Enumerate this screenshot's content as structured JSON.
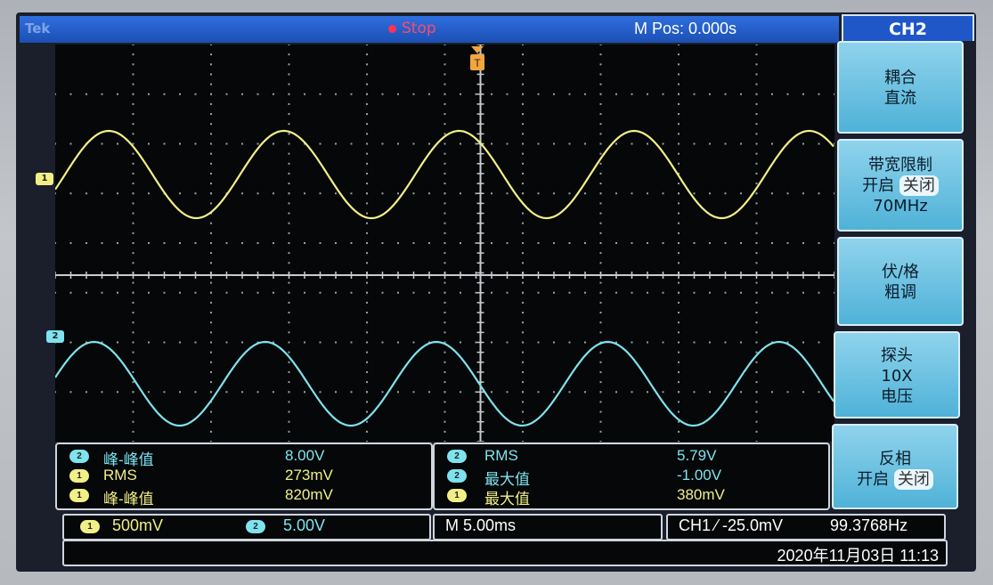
{
  "topbar": {
    "brand": "Tek",
    "status": "Stop",
    "mpos": "M Pos: 0.000s"
  },
  "trigger_marker": "T",
  "channels": {
    "ch1": {
      "label": "1",
      "color": "#f2ef86"
    },
    "ch2": {
      "label": "2",
      "color": "#7ee3ee"
    }
  },
  "measurements_left": [
    {
      "ch": "2",
      "name": "峰-峰值",
      "value": "8.00V"
    },
    {
      "ch": "1",
      "name": "RMS",
      "value": "273mV"
    },
    {
      "ch": "1",
      "name": "峰-峰值",
      "value": "820mV"
    }
  ],
  "measurements_right": [
    {
      "ch": "2",
      "name": "RMS",
      "value": "5.79V"
    },
    {
      "ch": "2",
      "name": "最大值",
      "value": "-1.00V"
    },
    {
      "ch": "1",
      "name": "最大值",
      "value": "380mV"
    }
  ],
  "status": {
    "ch1_badge": "1",
    "ch1_scale": "500mV",
    "ch2_badge": "2",
    "ch2_scale": "5.00V",
    "timebase": "M 5.00ms",
    "trigger": "CH1 ⁄ -25.0mV",
    "frequency": "99.3768Hz",
    "datetime": "2020年11月03日 11:13"
  },
  "menu": {
    "title": "CH2",
    "coupling": {
      "line1": "耦合",
      "line2": "直流"
    },
    "bw_limit": {
      "line1": "带宽限制",
      "on": "开启",
      "off": "关闭",
      "line3": "70MHz"
    },
    "volts_div": {
      "line1": "伏/格",
      "line2": "粗调"
    },
    "probe": {
      "line1": "探头",
      "line2": "10X",
      "line3": "电压"
    },
    "invert": {
      "line1": "反相",
      "on": "开启",
      "off": "关闭"
    }
  }
}
